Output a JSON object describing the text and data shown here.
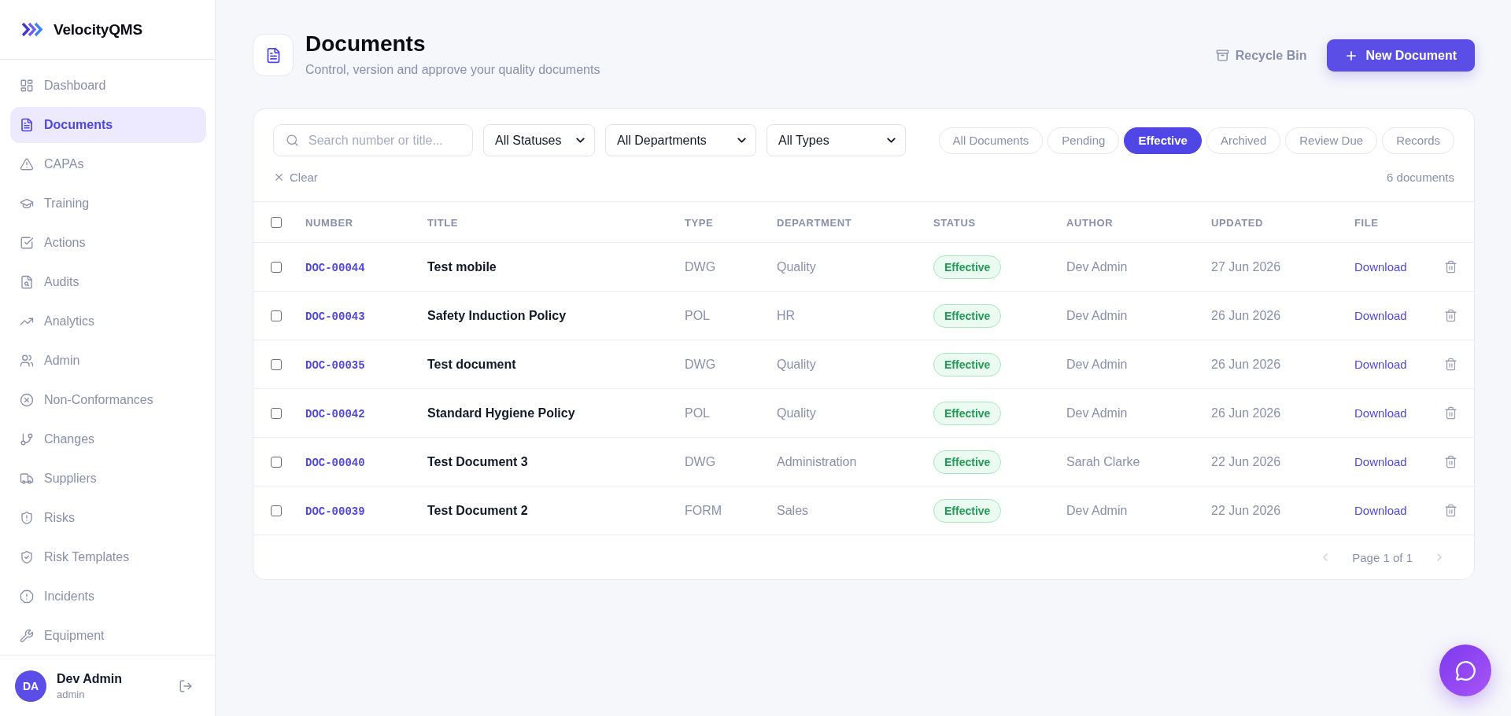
{
  "sidebar": {
    "brand": "VelocityQMS",
    "items": [
      {
        "label": "Dashboard",
        "selected": false
      },
      {
        "label": "Documents",
        "selected": true
      },
      {
        "label": "CAPAs",
        "selected": false
      },
      {
        "label": "Training",
        "selected": false
      },
      {
        "label": "Actions",
        "selected": false
      },
      {
        "label": "Audits",
        "selected": false
      },
      {
        "label": "Analytics",
        "selected": false
      },
      {
        "label": "Admin",
        "selected": false
      },
      {
        "label": "Non-Conformances",
        "selected": false
      },
      {
        "label": "Changes",
        "selected": false
      },
      {
        "label": "Suppliers",
        "selected": false
      },
      {
        "label": "Risks",
        "selected": false
      },
      {
        "label": "Risk Templates",
        "selected": false
      },
      {
        "label": "Incidents",
        "selected": false
      },
      {
        "label": "Equipment",
        "selected": false
      }
    ],
    "user": {
      "initials": "DA",
      "name": "Dev Admin",
      "role": "admin"
    }
  },
  "header": {
    "title": "Documents",
    "subtitle": "Control, version and approve your quality documents",
    "recycle_bin": "Recycle Bin",
    "new_button": "New Document"
  },
  "filters": {
    "search": {
      "placeholder": "Search number or title..."
    },
    "selects": [
      "All Statuses",
      "All Departments",
      "All Types"
    ],
    "tabs": [
      {
        "label": "All Documents",
        "selected": false
      },
      {
        "label": "Pending",
        "selected": false
      },
      {
        "label": "Effective",
        "selected": true
      },
      {
        "label": "Archived",
        "selected": false
      },
      {
        "label": "Review Due",
        "selected": false
      },
      {
        "label": "Records",
        "selected": false
      }
    ],
    "clear": "Clear",
    "count": "6 documents"
  },
  "table": {
    "select_all": {
      "checked": false
    },
    "columns": [
      "NUMBER",
      "TITLE",
      "TYPE",
      "DEPARTMENT",
      "STATUS",
      "AUTHOR",
      "UPDATED",
      "FILE"
    ],
    "rows": [
      {
        "checked": false,
        "number": "DOC-00044",
        "title": "Test mobile",
        "type": "DWG",
        "department": "Quality",
        "status": "Effective",
        "author": "Dev Admin",
        "updated": "27 Jun 2026",
        "file": "Download"
      },
      {
        "checked": false,
        "number": "DOC-00043",
        "title": "Safety Induction Policy",
        "type": "POL",
        "department": "HR",
        "status": "Effective",
        "author": "Dev Admin",
        "updated": "26 Jun 2026",
        "file": "Download"
      },
      {
        "checked": false,
        "number": "DOC-00035",
        "title": "Test document",
        "type": "DWG",
        "department": "Quality",
        "status": "Effective",
        "author": "Dev Admin",
        "updated": "26 Jun 2026",
        "file": "Download"
      },
      {
        "checked": false,
        "number": "DOC-00042",
        "title": "Standard Hygiene Policy",
        "type": "POL",
        "department": "Quality",
        "status": "Effective",
        "author": "Dev Admin",
        "updated": "26 Jun 2026",
        "file": "Download"
      },
      {
        "checked": false,
        "number": "DOC-00040",
        "title": "Test Document 3",
        "type": "DWG",
        "department": "Administration",
        "status": "Effective",
        "author": "Sarah Clarke",
        "updated": "22 Jun 2026",
        "file": "Download"
      },
      {
        "checked": false,
        "number": "DOC-00039",
        "title": "Test Document 2",
        "type": "FORM",
        "department": "Sales",
        "status": "Effective",
        "author": "Dev Admin",
        "updated": "22 Jun 2026",
        "file": "Download"
      }
    ]
  },
  "pagination": {
    "label": "Page 1 of 1",
    "prev": {
      "disabled": true
    },
    "next": {
      "disabled": true
    }
  }
}
